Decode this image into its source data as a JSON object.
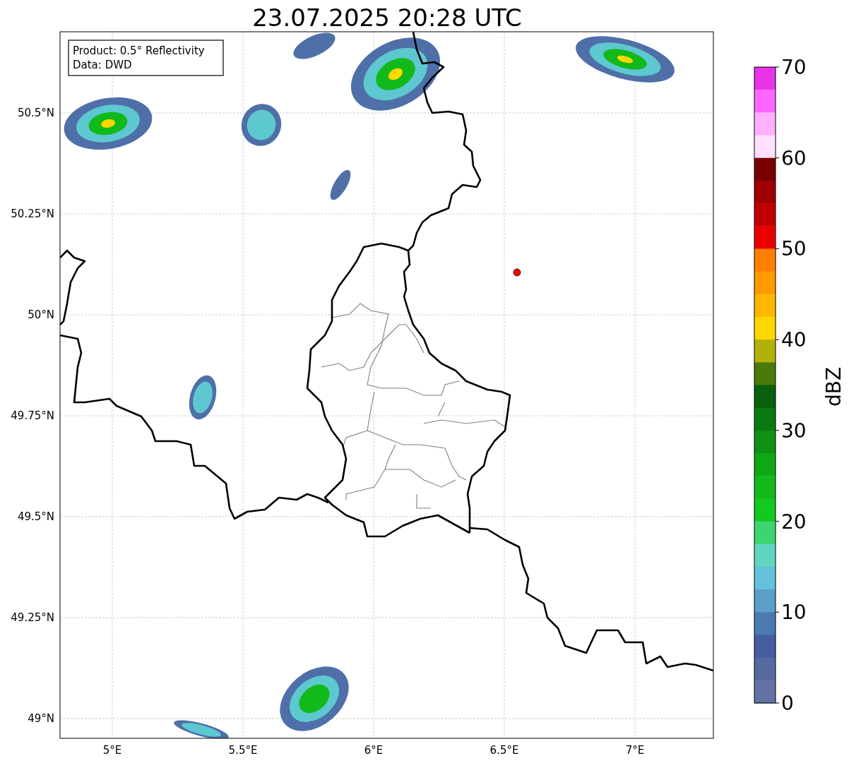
{
  "title": "23.07.2025 20:28 UTC",
  "info_box": [
    "Product: 0.5° Reflectivity",
    "Data: DWD"
  ],
  "map": {
    "y_tick_labels": [
      "50.5°N",
      "50.25°N",
      "50°N",
      "49.75°N",
      "49.5°N",
      "49.25°N",
      "49°N"
    ],
    "x_tick_labels": [
      "5°E",
      "5.5°E",
      "6°E",
      "6.5°E",
      "7°E"
    ]
  },
  "colorbar": {
    "label": "dBZ",
    "ticks": [
      "70",
      "60",
      "50",
      "40",
      "30",
      "20",
      "10",
      "0"
    ],
    "bands": [
      {
        "color": "#e833e8"
      },
      {
        "color": "#ff66ff"
      },
      {
        "color": "#ffb0ff"
      },
      {
        "color": "#ffe0ff"
      },
      {
        "color": "#7a0000"
      },
      {
        "color": "#a00000"
      },
      {
        "color": "#c00000"
      },
      {
        "color": "#e80000"
      },
      {
        "color": "#ff7f00"
      },
      {
        "color": "#ff9a00"
      },
      {
        "color": "#ffb800"
      },
      {
        "color": "#ffd700"
      },
      {
        "color": "#b1b10a"
      },
      {
        "color": "#497a0a"
      },
      {
        "color": "#0a5f0c"
      },
      {
        "color": "#0b7a11"
      },
      {
        "color": "#0e9114"
      },
      {
        "color": "#0ea815"
      },
      {
        "color": "#12b91a"
      },
      {
        "color": "#11c91f"
      },
      {
        "color": "#3dd56f"
      },
      {
        "color": "#61d5c0"
      },
      {
        "color": "#63c1dc"
      },
      {
        "color": "#5b9ec8"
      },
      {
        "color": "#4a7ab0"
      },
      {
        "color": "#445ea0"
      },
      {
        "color": "#55699e"
      },
      {
        "color": "#6272a5"
      }
    ]
  }
}
